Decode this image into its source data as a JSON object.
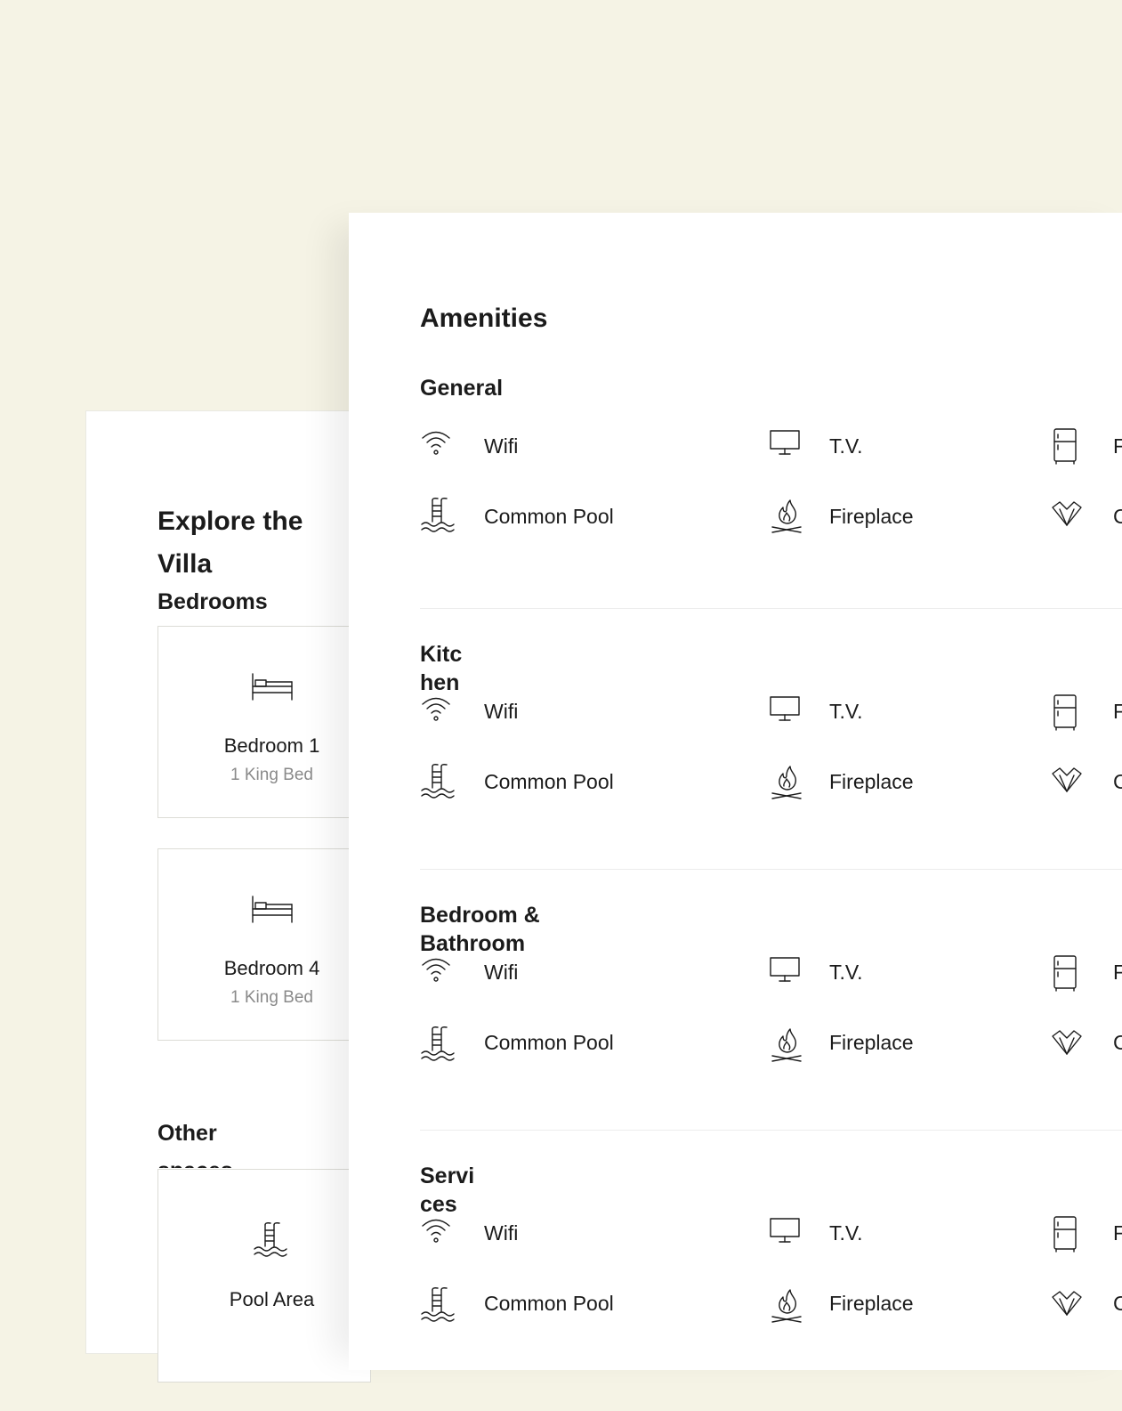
{
  "explore": {
    "title": "Explore the Villa",
    "bedrooms_heading": "Bedrooms",
    "bedrooms": [
      {
        "name": "Bedroom 1",
        "beds": "1 King Bed",
        "icon": "bed-icon"
      },
      {
        "name": "Bedroom 4",
        "beds": "1 King Bed",
        "icon": "bed-icon"
      }
    ],
    "other_heading": "Other spaces",
    "other_spaces": [
      {
        "name": "Pool Area",
        "icon": "pool-icon"
      }
    ]
  },
  "amenities": {
    "title": "Amenities",
    "sections": [
      {
        "title": "General",
        "items": [
          {
            "label": "Wifi",
            "icon": "wifi-icon"
          },
          {
            "label": "T.V.",
            "icon": "tv-icon"
          },
          {
            "label": "F",
            "icon": "fridge-icon"
          },
          {
            "label": "Common Pool",
            "icon": "pool-icon"
          },
          {
            "label": "Fireplace",
            "icon": "fireplace-icon"
          },
          {
            "label": "C",
            "icon": "leaf-icon"
          }
        ]
      },
      {
        "title": "Kitchen",
        "items": [
          {
            "label": "Wifi",
            "icon": "wifi-icon"
          },
          {
            "label": "T.V.",
            "icon": "tv-icon"
          },
          {
            "label": "F",
            "icon": "fridge-icon"
          },
          {
            "label": "Common Pool",
            "icon": "pool-icon"
          },
          {
            "label": "Fireplace",
            "icon": "fireplace-icon"
          },
          {
            "label": "C",
            "icon": "leaf-icon"
          }
        ]
      },
      {
        "title": "Bedroom & Bathroom",
        "items": [
          {
            "label": "Wifi",
            "icon": "wifi-icon"
          },
          {
            "label": "T.V.",
            "icon": "tv-icon"
          },
          {
            "label": "F",
            "icon": "fridge-icon"
          },
          {
            "label": "Common Pool",
            "icon": "pool-icon"
          },
          {
            "label": "Fireplace",
            "icon": "fireplace-icon"
          },
          {
            "label": "C",
            "icon": "leaf-icon"
          }
        ]
      },
      {
        "title": "Services",
        "items": [
          {
            "label": "Wifi",
            "icon": "wifi-icon"
          },
          {
            "label": "T.V.",
            "icon": "tv-icon"
          },
          {
            "label": "F",
            "icon": "fridge-icon"
          },
          {
            "label": "Common Pool",
            "icon": "pool-icon"
          },
          {
            "label": "Fireplace",
            "icon": "fireplace-icon"
          },
          {
            "label": "C",
            "icon": "leaf-icon"
          }
        ]
      }
    ]
  }
}
